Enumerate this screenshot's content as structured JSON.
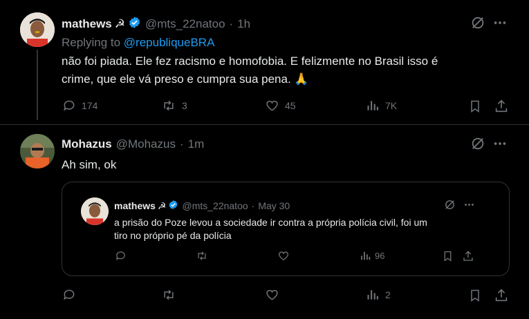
{
  "tweet1": {
    "name": "mathews",
    "name_emoji": "☭",
    "handle": "@mts_22natoo",
    "sep": "·",
    "time": "1h",
    "replying_prefix": "Replying to",
    "replying_to": "@republiqueBRA",
    "text_line1": "não foi piada. Ele fez racismo e homofobia. E felizmente no Brasil isso é",
    "text_line2": "crime, que ele vá preso e cumpra sua pena. 🙏",
    "stats": {
      "replies": "174",
      "reposts": "3",
      "likes": "45",
      "views": "7K"
    }
  },
  "tweet2": {
    "name": "Mohazus",
    "handle": "@Mohazus",
    "sep": "·",
    "time": "1m",
    "text": "Ah sim, ok",
    "stats": {
      "replies": "",
      "reposts": "",
      "likes": "",
      "views": "2"
    }
  },
  "quote": {
    "name": "mathews",
    "name_emoji": "☭",
    "handle": "@mts_22natoo",
    "sep": "·",
    "time": "May 30",
    "text_line1": "a prisão do Poze levou a sociedade ir contra a própria polícia civil, foi um",
    "text_line2": "tiro no próprio pé da polícia",
    "stats": {
      "views": "96"
    }
  },
  "colors": {
    "accent": "#1d9bf0",
    "muted": "#71767b",
    "text": "#e7e9ea",
    "bg": "#000000"
  }
}
